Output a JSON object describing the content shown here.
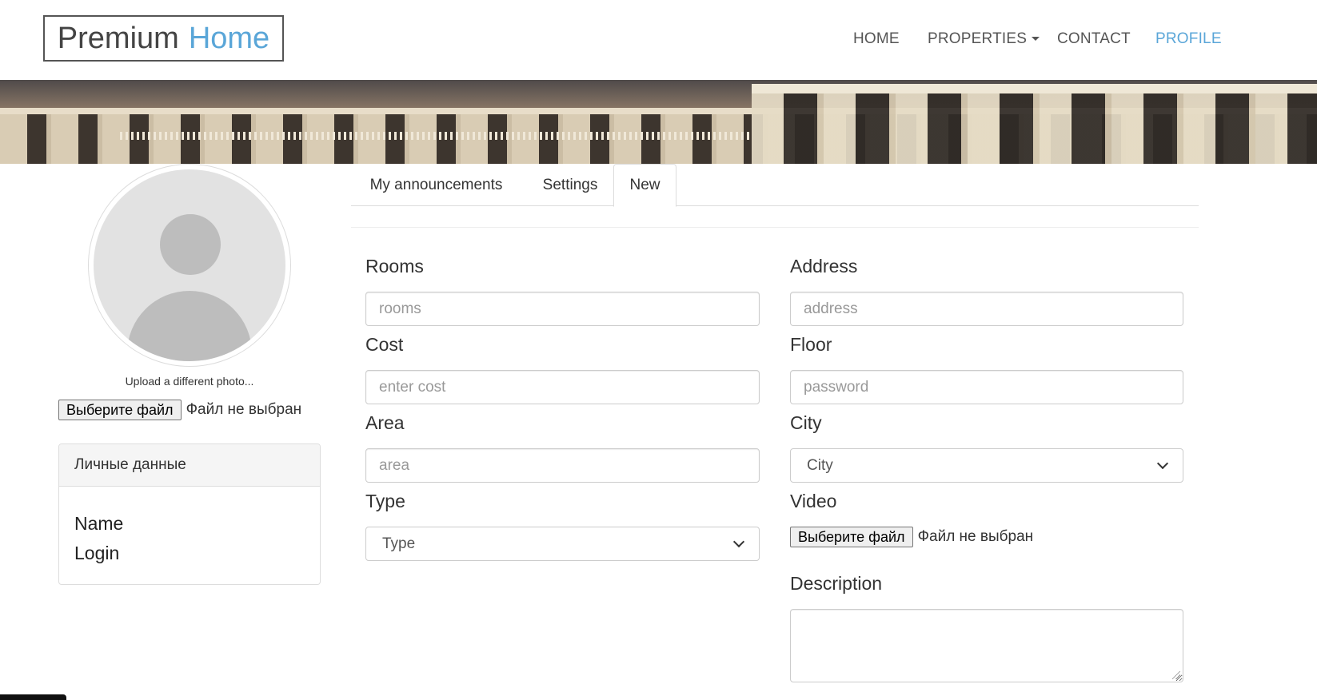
{
  "header": {
    "logo": {
      "part1": "Premium",
      "part2": "Home"
    },
    "nav": [
      {
        "label": "HOME",
        "active": false
      },
      {
        "label": "PROPERTIES",
        "active": false,
        "dropdown": true
      },
      {
        "label": "CONTACT",
        "active": false
      },
      {
        "label": "PROFILE",
        "active": true
      }
    ]
  },
  "profile": {
    "upload_caption": "Upload a different photo...",
    "file_button": "Выберите файл",
    "file_status": "Файл не выбран",
    "panel": {
      "title": "Личные данные",
      "fields": [
        "Name",
        "Login"
      ]
    }
  },
  "tabs": [
    {
      "label": "My announcements",
      "active": false
    },
    {
      "label": "Settings",
      "active": false
    },
    {
      "label": "New",
      "active": true
    }
  ],
  "form": {
    "rooms": {
      "label": "Rooms",
      "placeholder": "rooms",
      "value": ""
    },
    "cost": {
      "label": "Cost",
      "placeholder": "enter cost",
      "value": ""
    },
    "area": {
      "label": "Area",
      "placeholder": "area",
      "value": ""
    },
    "type": {
      "label": "Type",
      "selected": "Type"
    },
    "address": {
      "label": "Address",
      "placeholder": "address",
      "value": ""
    },
    "floor": {
      "label": "Floor",
      "placeholder": "password",
      "value": ""
    },
    "city": {
      "label": "City",
      "selected": "City"
    },
    "video": {
      "label": "Video",
      "file_button": "Выберите файл",
      "file_status": "Файл не выбран"
    },
    "description": {
      "label": "Description",
      "value": ""
    }
  },
  "colors": {
    "accent": "#5aa6d8",
    "text": "#333333",
    "border": "#cccccc",
    "panel_heading_bg": "#f5f5f5"
  },
  "icons": {
    "properties_dropdown": "caret-down-icon",
    "select_arrow": "chevron-down-icon",
    "avatar": "user-silhouette-icon"
  }
}
